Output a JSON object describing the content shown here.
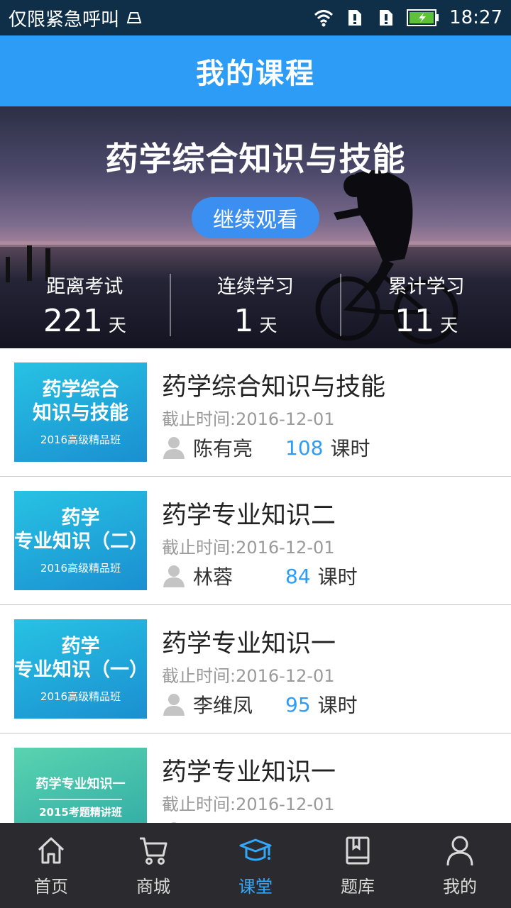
{
  "status_bar": {
    "carrier": "仅限紧急呼叫",
    "time": "18:27",
    "icons": [
      "sim-icon",
      "wifi-icon",
      "sim1-alert-icon",
      "sim2-alert-icon",
      "battery-charging-icon"
    ]
  },
  "header": {
    "title": "我的课程"
  },
  "hero": {
    "course_title": "药学综合知识与技能",
    "continue_label": "继续观看",
    "stats": [
      {
        "label": "距离考试",
        "value": "221",
        "unit": "天"
      },
      {
        "label": "连续学习",
        "value": "1",
        "unit": "天"
      },
      {
        "label": "累计学习",
        "value": "11",
        "unit": "天"
      }
    ]
  },
  "courses": [
    {
      "name": "药学综合知识与技能",
      "deadline": "截止时间:2016-12-01",
      "teacher": "陈有亮",
      "hours": "108",
      "hours_unit": "课时",
      "cover": {
        "line1": "药学综合",
        "line2": "知识与技能",
        "sub": "2016高级精品班",
        "color": "#1a9ad6"
      }
    },
    {
      "name": "药学专业知识二",
      "deadline": "截止时间:2016-12-01",
      "teacher": "林蓉",
      "hours": "84",
      "hours_unit": "课时",
      "cover": {
        "line1": "药学",
        "line2": "专业知识（二）",
        "sub": "2016高级精品班",
        "color": "#1a9ad6"
      }
    },
    {
      "name": "药学专业知识一",
      "deadline": "截止时间:2016-12-01",
      "teacher": "李维凤",
      "hours": "95",
      "hours_unit": "课时",
      "cover": {
        "line1": "药学",
        "line2": "专业知识（一）",
        "sub": "2016高级精品班",
        "color": "#1a9ad6"
      }
    },
    {
      "name": "药学专业知识一",
      "deadline": "截止时间:2016-12-01",
      "teacher": "",
      "hours": "",
      "hours_unit": "",
      "cover": {
        "line1": "药学专业知识一",
        "line2": "",
        "sub": "2015考题精讲班",
        "color": "#3dbfa8"
      }
    }
  ],
  "bottom_nav": {
    "active_color": "#34a8f8",
    "items": [
      {
        "label": "首页",
        "icon": "home-icon",
        "active": false
      },
      {
        "label": "商城",
        "icon": "cart-icon",
        "active": false
      },
      {
        "label": "课堂",
        "icon": "graduation-cap-icon",
        "active": true
      },
      {
        "label": "题库",
        "icon": "book-icon",
        "active": false
      },
      {
        "label": "我的",
        "icon": "person-icon",
        "active": false
      }
    ]
  }
}
